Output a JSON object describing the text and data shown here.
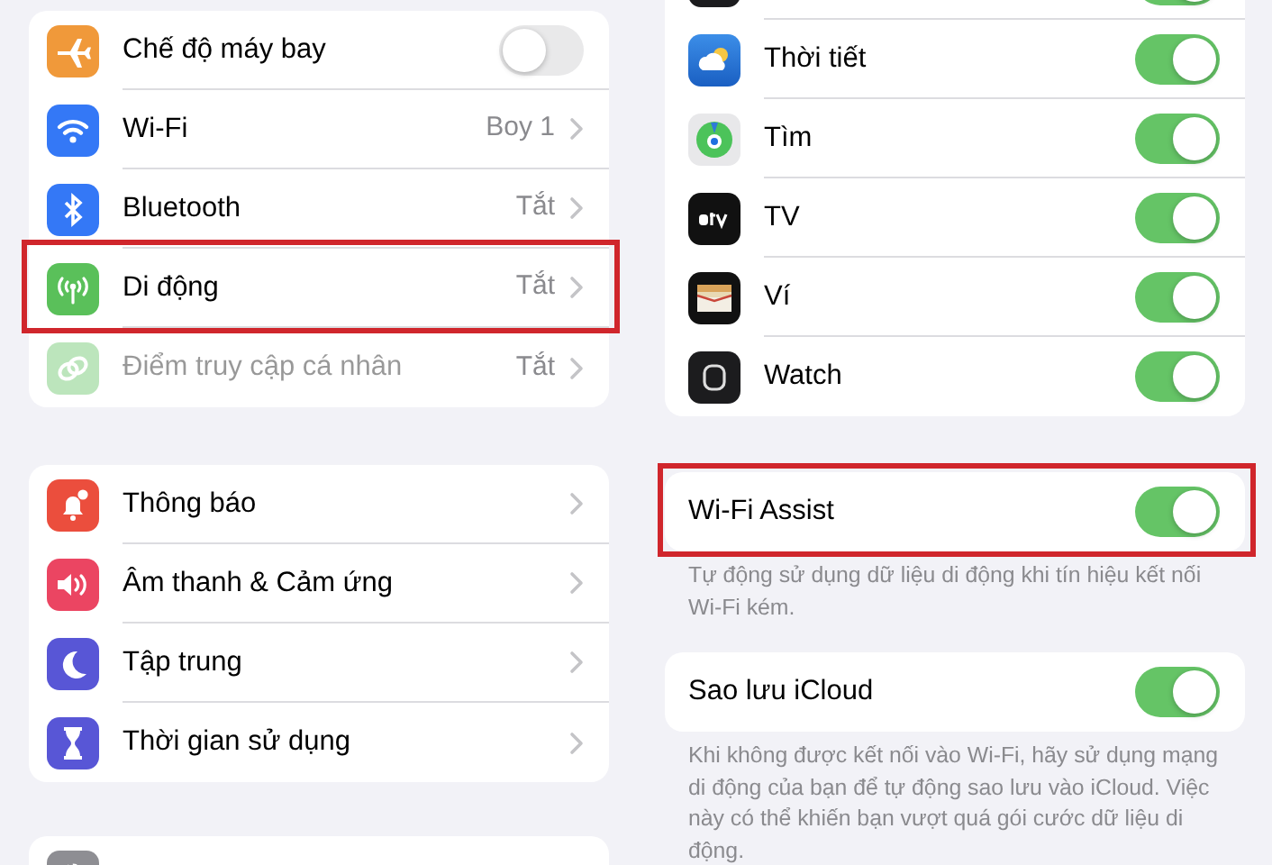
{
  "left_groups": [
    {
      "rows": [
        {
          "kind": "toggle",
          "label": "Chế độ máy bay",
          "on": false,
          "disabled": false,
          "highlighted": false
        },
        {
          "kind": "link",
          "label": "Wi-Fi",
          "value": "Boy 1",
          "disabled": false,
          "highlighted": false
        },
        {
          "kind": "link",
          "label": "Bluetooth",
          "value": "Tắt",
          "disabled": false,
          "highlighted": false
        },
        {
          "kind": "link",
          "label": "Di động",
          "value": "Tắt",
          "disabled": false,
          "highlighted": true
        },
        {
          "kind": "link",
          "label": "Điểm truy cập cá nhân",
          "value": "Tắt",
          "disabled": true,
          "highlighted": false
        }
      ]
    },
    {
      "rows": [
        {
          "kind": "link",
          "label": "Thông báo",
          "highlighted": false
        },
        {
          "kind": "link",
          "label": "Âm thanh & Cảm ứng",
          "highlighted": false
        },
        {
          "kind": "link",
          "label": "Tập trung",
          "highlighted": false
        },
        {
          "kind": "link",
          "label": "Thời gian sử dụng",
          "highlighted": false
        }
      ]
    },
    {
      "rows": [
        {
          "kind": "partial",
          "highlighted": false
        }
      ]
    }
  ],
  "right_groups": [
    {
      "rows": [
        {
          "kind": "toggle",
          "on": true,
          "highlighted": false
        },
        {
          "kind": "toggle",
          "label": "Thời tiết",
          "on": true,
          "highlighted": false
        },
        {
          "kind": "toggle",
          "label": "Tìm",
          "on": true,
          "highlighted": false
        },
        {
          "kind": "toggle",
          "label": "TV",
          "on": true,
          "highlighted": false
        },
        {
          "kind": "toggle",
          "label": "Ví",
          "on": true,
          "highlighted": false
        },
        {
          "kind": "toggle",
          "label": "Watch",
          "on": true,
          "highlighted": false
        }
      ]
    },
    {
      "rows": [
        {
          "kind": "toggle",
          "label": "Wi-Fi Assist",
          "on": true,
          "highlighted": true
        }
      ],
      "footer": "Tự động sử dụng dữ liệu di động khi tín hiệu kết nối Wi-Fi kém."
    },
    {
      "rows": [
        {
          "kind": "toggle",
          "label": "Sao lưu iCloud",
          "on": true,
          "highlighted": false
        }
      ],
      "footer": "Khi không được kết nối vào Wi-Fi, hãy sử dụng mạng di động của bạn để tự động sao lưu vào iCloud. Việc này có thể khiến bạn vượt quá gói cước dữ liệu di động."
    }
  ]
}
